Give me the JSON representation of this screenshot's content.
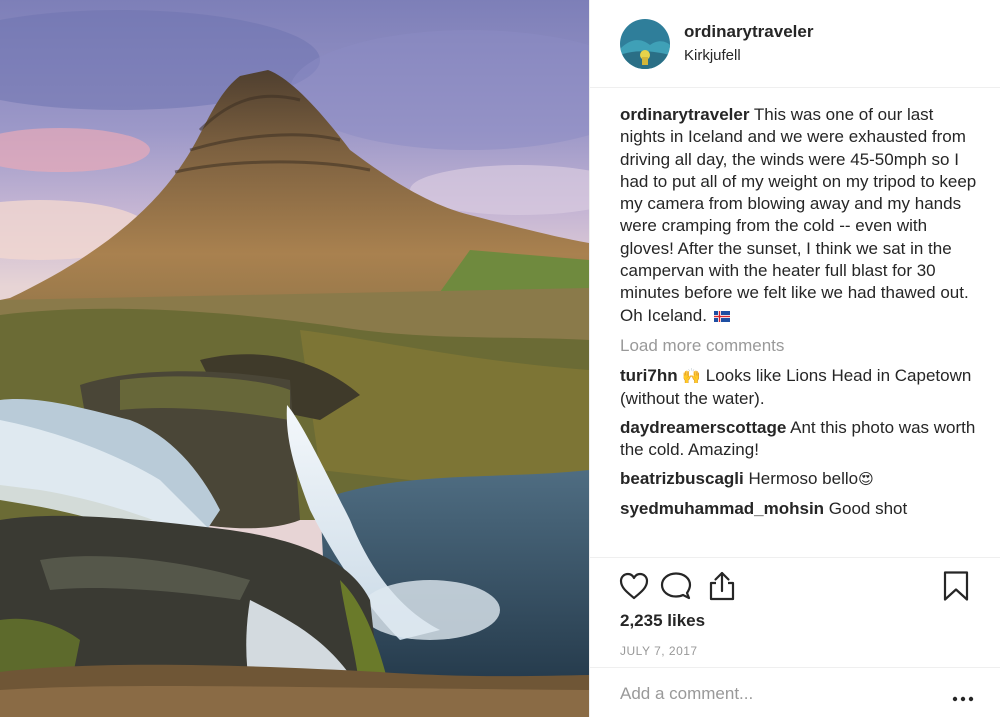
{
  "header": {
    "username": "ordinarytraveler",
    "location": "Kirkjufell"
  },
  "caption": {
    "username": "ordinarytraveler",
    "text": "This was one of our last nights in Iceland and we were exhausted from driving all day, the winds were 45-50mph so I had to put all of my weight on my tripod to keep my camera from blowing away and my hands were cramping from the cold -- even with gloves! After the sunset, I think we sat in the campervan with the heater full blast for 30 minutes before we felt like we had thawed out. Oh Iceland.",
    "emoji": "iceland-flag"
  },
  "load_more": "Load more comments",
  "comments": [
    {
      "username": "turi7hn",
      "emoji": "🙌",
      "text": "Looks like Lions Head in Capetown (without the water)."
    },
    {
      "username": "daydreamerscottage",
      "text": "Ant this photo was worth the cold. Amazing!"
    },
    {
      "username": "beatrizbuscagli",
      "text": "Hermoso bello",
      "emoji": "😍"
    },
    {
      "username": "syedmuhammad_mohsin",
      "text": "Good shot"
    }
  ],
  "actions": {
    "icons": [
      "heart-icon",
      "comment-icon",
      "share-icon",
      "bookmark-icon"
    ]
  },
  "likes": "2,235 likes",
  "date": "JULY 7, 2017",
  "add_comment": {
    "placeholder": "Add a comment...",
    "icon": "more-options-icon"
  },
  "colors": {
    "text": "#262626",
    "muted": "#999999",
    "divider": "#efefef"
  }
}
